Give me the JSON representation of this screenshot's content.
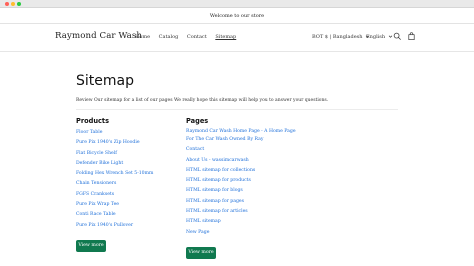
{
  "announcement": "Welcome to our store",
  "header": {
    "logo": "Raymond Car Wash",
    "nav": [
      "Home",
      "Catalog",
      "Contact",
      "Sitemap"
    ],
    "active_nav": "Sitemap",
    "country": "BOT $ | Bangladesh",
    "language": "English",
    "icons": [
      "search-icon",
      "cart-icon",
      "chevron-down-icon"
    ]
  },
  "main": {
    "title": "Sitemap",
    "description": "Review Our sitemap for a list of our pages We really hope this sitemap will help you to answer your questions.",
    "products": {
      "heading": "Products",
      "items": [
        "Floor Table",
        "Pure Pix 1940's Zip Hoodie",
        "Flat Bicycle Shelf",
        "Defender Bike Light",
        "Folding Hex Wrench Set 5-10mm",
        "Chain Tensioners",
        "FGFS Cranksets",
        "Pure Pix Wrap Tee",
        "Conti Race Table",
        "Pure Pix 1940's Pullover"
      ],
      "button": "View more"
    },
    "pages": {
      "heading": "Pages",
      "items": [
        "Raymond Car Wash Home Page - A Home Page",
        "For The Car Wash Owned By Ray",
        "Contact",
        "About Us - wassimcarwash",
        "HTML sitemap for collections",
        "HTML sitemap for products",
        "HTML sitemap for blogs",
        "HTML sitemap for pages",
        "HTML sitemap for articles",
        "HTML sitemap",
        "New Page"
      ],
      "button": "View more"
    }
  },
  "colors": {
    "link": "#1e6fd9",
    "button": "#10794f"
  }
}
